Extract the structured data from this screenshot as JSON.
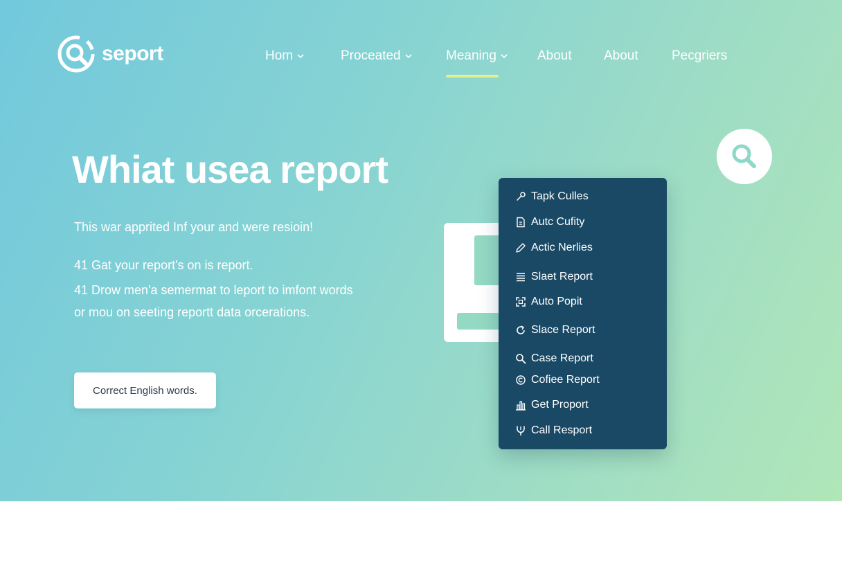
{
  "brand": {
    "name": "seport"
  },
  "nav": {
    "items": [
      {
        "label": "Hom",
        "has_dropdown": true
      },
      {
        "label": "Proceated",
        "has_dropdown": true
      },
      {
        "label": "Meaning",
        "has_dropdown": true,
        "active": true
      },
      {
        "label": "About",
        "has_dropdown": false
      },
      {
        "label": "About",
        "has_dropdown": false
      },
      {
        "label": "Pecgriers",
        "has_dropdown": false
      }
    ]
  },
  "hero": {
    "headline": "Whiat usea report",
    "subtitle": "This war apprited Inf your and were resioin!",
    "lines": [
      "41 Gat your report's on is report.",
      "41 Drow men'a semermat to leport to imfont words",
      "or mou on seeting reportt data orcerations."
    ],
    "cta_label": "Correct English words."
  },
  "menu": {
    "items": [
      {
        "label": "Tapk Culles",
        "icon": "link-icon"
      },
      {
        "label": "Autc Cufity",
        "icon": "document-icon"
      },
      {
        "label": "Actic Nerlies",
        "icon": "pencil-icon"
      },
      {
        "label": "Slaet Report",
        "icon": "list-icon"
      },
      {
        "label": "Auto Popit",
        "icon": "frame-icon"
      },
      {
        "label": "Slace Report",
        "icon": "refresh-icon"
      },
      {
        "label": "Case Report",
        "icon": "search-icon"
      },
      {
        "label": "Cofiee Report",
        "icon": "copyright-icon"
      },
      {
        "label": "Get Proport",
        "icon": "chart-icon"
      },
      {
        "label": "Call Resport",
        "icon": "fork-icon"
      }
    ]
  },
  "colors": {
    "gradient_start": "#72c8dc",
    "gradient_end": "#b0e6b8",
    "menu_bg": "#1a4966",
    "active_underline": "#e3f08d",
    "text": "#ffffff"
  }
}
